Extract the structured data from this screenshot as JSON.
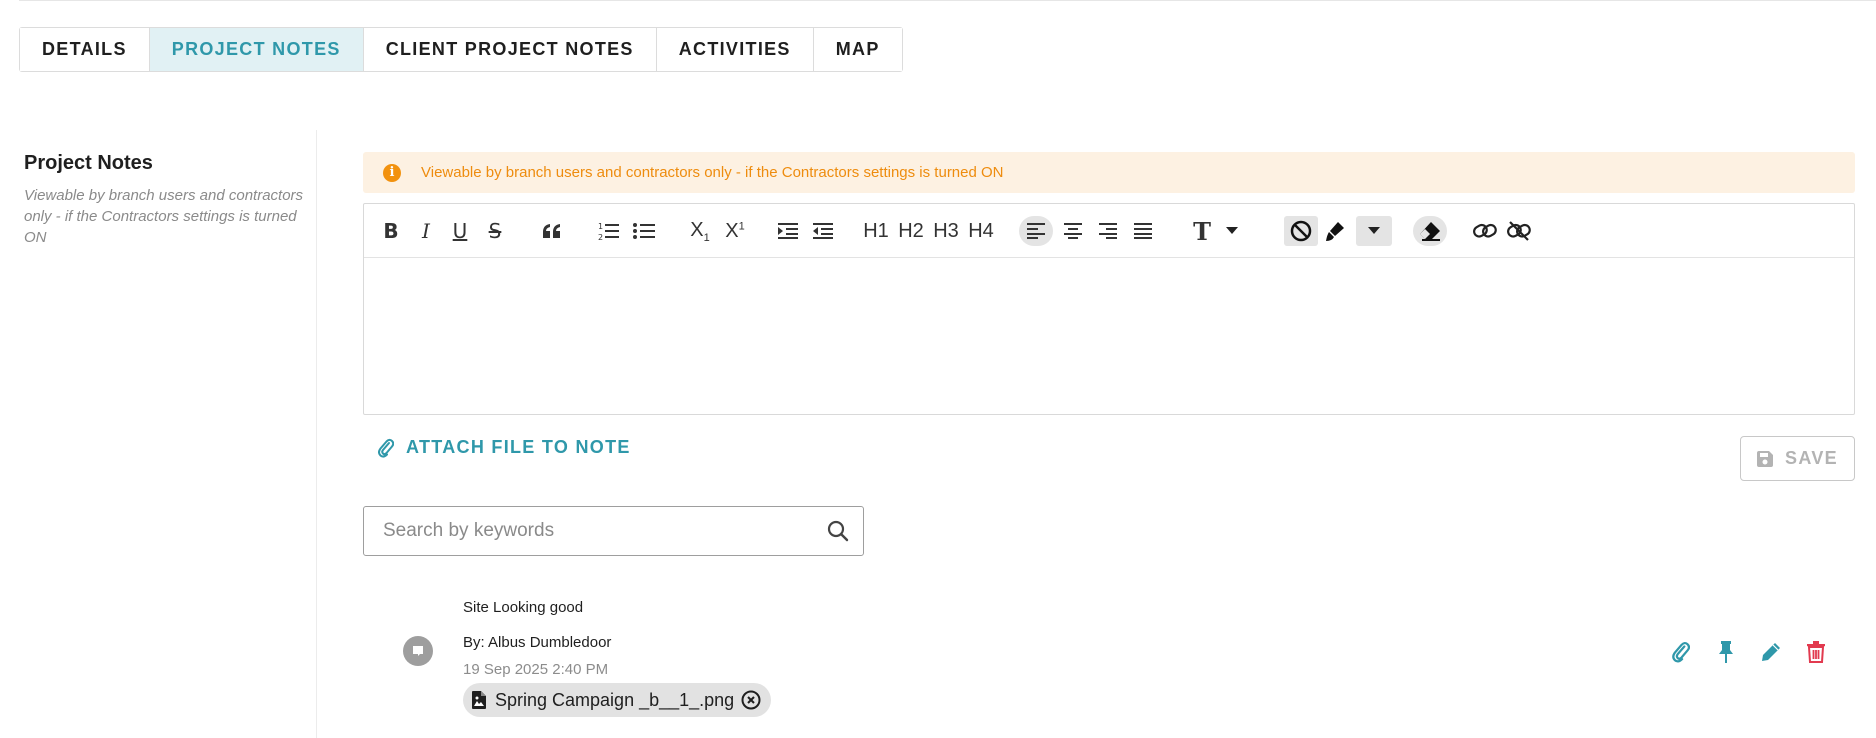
{
  "tabs": [
    {
      "label": "DETAILS",
      "active": false
    },
    {
      "label": "PROJECT NOTES",
      "active": true
    },
    {
      "label": "CLIENT PROJECT NOTES",
      "active": false
    },
    {
      "label": "ACTIVITIES",
      "active": false
    },
    {
      "label": "MAP",
      "active": false
    }
  ],
  "section": {
    "title": "Project Notes",
    "description": "Viewable by branch users and contractors only - if the Contractors settings is turned ON"
  },
  "alert": {
    "icon": "info-icon",
    "text": "Viewable by branch users and contractors only - if the Contractors settings is turned ON",
    "color": "#ee8c0e"
  },
  "editor": {
    "toolbar": {
      "h1": "H1",
      "h2": "H2",
      "h3": "H3",
      "h4": "H4",
      "font_size_glyph": "T",
      "subscript_base": "X",
      "subscript_mark": "1",
      "superscript_base": "X",
      "superscript_mark": "1",
      "bold": "B",
      "italic": "I",
      "underline": "U",
      "strike": "S"
    },
    "content": ""
  },
  "attach": {
    "label": "ATTACH FILE TO NOTE"
  },
  "save": {
    "label": "SAVE",
    "enabled": false
  },
  "search": {
    "placeholder": "Search by keywords",
    "value": ""
  },
  "notes": [
    {
      "text": "Site Looking good",
      "author": "By: Albus Dumbledoor",
      "date": "19 Sep 2025 2:40 PM",
      "attachment": "Spring Campaign _b__1_.png"
    }
  ],
  "colors": {
    "accent": "#2f98aa",
    "danger": "#e23a4f",
    "tab_active_bg": "#e1f1f4",
    "alert_bg": "#fdf1e2"
  }
}
